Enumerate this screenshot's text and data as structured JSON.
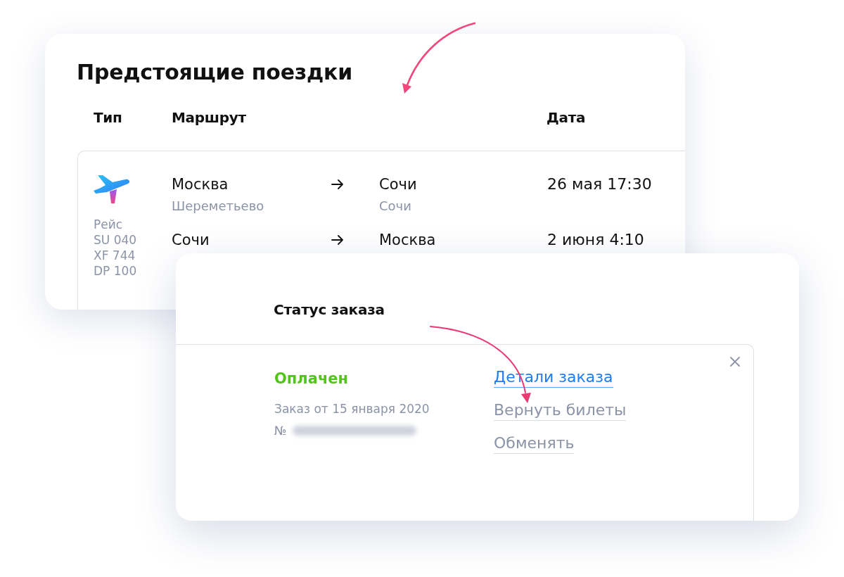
{
  "trips_panel": {
    "title": "Предстоящие поездки",
    "columns": [
      "Тип",
      "Маршрут",
      "Дата"
    ],
    "trips": [
      {
        "kind": "flight",
        "type_label": "Рейс",
        "flight_numbers": [
          "SU 040",
          "XF 744",
          "DP 100"
        ],
        "legs": [
          {
            "from": {
              "city": "Москва",
              "airport": "Шереметьево"
            },
            "to": {
              "city": "Сочи",
              "airport": "Сочи"
            },
            "date": "26 мая 17:30"
          },
          {
            "from": {
              "city": "Сочи"
            },
            "to": {
              "city": "Москва"
            },
            "date": "2 июня 4:10"
          }
        ]
      }
    ]
  },
  "order_status_panel": {
    "title": "Статус заказа",
    "status": {
      "label": "Оплачен",
      "kind": "paid"
    },
    "order_date": "Заказ от 15 января 2020",
    "number_label": "№",
    "actions": [
      {
        "label": "Детали заказа",
        "kind": "primary"
      },
      {
        "label": "Вернуть билеты",
        "kind": "secondary"
      },
      {
        "label": "Обменять",
        "kind": "secondary"
      }
    ]
  }
}
